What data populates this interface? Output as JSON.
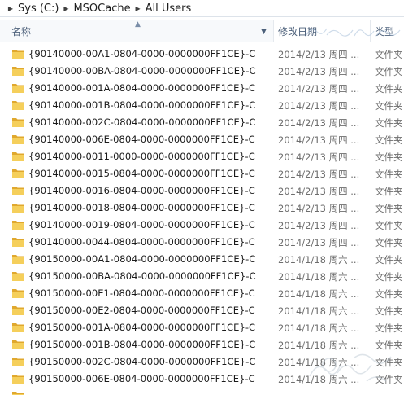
{
  "breadcrumb": {
    "items": [
      "Sys (C:)",
      "MSOCache",
      "All Users"
    ]
  },
  "columns": {
    "name": "名称",
    "date": "修改日期",
    "type": "类型"
  },
  "rows": [
    {
      "name": "{90140000-00A1-0804-0000-0000000FF1CE}-C",
      "date": "2014/2/13 周四 ...",
      "type": "文件夹"
    },
    {
      "name": "{90140000-00BA-0804-0000-0000000FF1CE}-C",
      "date": "2014/2/13 周四 ...",
      "type": "文件夹"
    },
    {
      "name": "{90140000-001A-0804-0000-0000000FF1CE}-C",
      "date": "2014/2/13 周四 ...",
      "type": "文件夹"
    },
    {
      "name": "{90140000-001B-0804-0000-0000000FF1CE}-C",
      "date": "2014/2/13 周四 ...",
      "type": "文件夹"
    },
    {
      "name": "{90140000-002C-0804-0000-0000000FF1CE}-C",
      "date": "2014/2/13 周四 ...",
      "type": "文件夹"
    },
    {
      "name": "{90140000-006E-0804-0000-0000000FF1CE}-C",
      "date": "2014/2/13 周四 ...",
      "type": "文件夹"
    },
    {
      "name": "{90140000-0011-0000-0000-0000000FF1CE}-C",
      "date": "2014/2/13 周四 ...",
      "type": "文件夹"
    },
    {
      "name": "{90140000-0015-0804-0000-0000000FF1CE}-C",
      "date": "2014/2/13 周四 ...",
      "type": "文件夹"
    },
    {
      "name": "{90140000-0016-0804-0000-0000000FF1CE}-C",
      "date": "2014/2/13 周四 ...",
      "type": "文件夹"
    },
    {
      "name": "{90140000-0018-0804-0000-0000000FF1CE}-C",
      "date": "2014/2/13 周四 ...",
      "type": "文件夹"
    },
    {
      "name": "{90140000-0019-0804-0000-0000000FF1CE}-C",
      "date": "2014/2/13 周四 ...",
      "type": "文件夹"
    },
    {
      "name": "{90140000-0044-0804-0000-0000000FF1CE}-C",
      "date": "2014/2/13 周四 ...",
      "type": "文件夹"
    },
    {
      "name": "{90150000-00A1-0804-0000-0000000FF1CE}-C",
      "date": "2014/1/18 周六 ...",
      "type": "文件夹"
    },
    {
      "name": "{90150000-00BA-0804-0000-0000000FF1CE}-C",
      "date": "2014/1/18 周六 ...",
      "type": "文件夹"
    },
    {
      "name": "{90150000-00E1-0804-0000-0000000FF1CE}-C",
      "date": "2014/1/18 周六 ...",
      "type": "文件夹"
    },
    {
      "name": "{90150000-00E2-0804-0000-0000000FF1CE}-C",
      "date": "2014/1/18 周六 ...",
      "type": "文件夹"
    },
    {
      "name": "{90150000-001A-0804-0000-0000000FF1CE}-C",
      "date": "2014/1/18 周六 ...",
      "type": "文件夹"
    },
    {
      "name": "{90150000-001B-0804-0000-0000000FF1CE}-C",
      "date": "2014/1/18 周六 ...",
      "type": "文件夹"
    },
    {
      "name": "{90150000-002C-0804-0000-0000000FF1CE}-C",
      "date": "2014/1/18 周六 ...",
      "type": "文件夹"
    },
    {
      "name": "{90150000-006E-0804-0000-0000000FF1CE}-C",
      "date": "2014/1/18 周六 ...",
      "type": "文件夹"
    }
  ],
  "icons": {
    "folder": "folder-icon",
    "breadcrumb_separator": "chevron-right-icon",
    "sort": "sort-ascending-icon",
    "column_dropdown": "chevron-down-icon"
  },
  "colors": {
    "folder_back": "#e0a82e",
    "folder_front": "#f5cf5b",
    "header_text": "#4c607a",
    "date_text": "#6d6d6d"
  }
}
